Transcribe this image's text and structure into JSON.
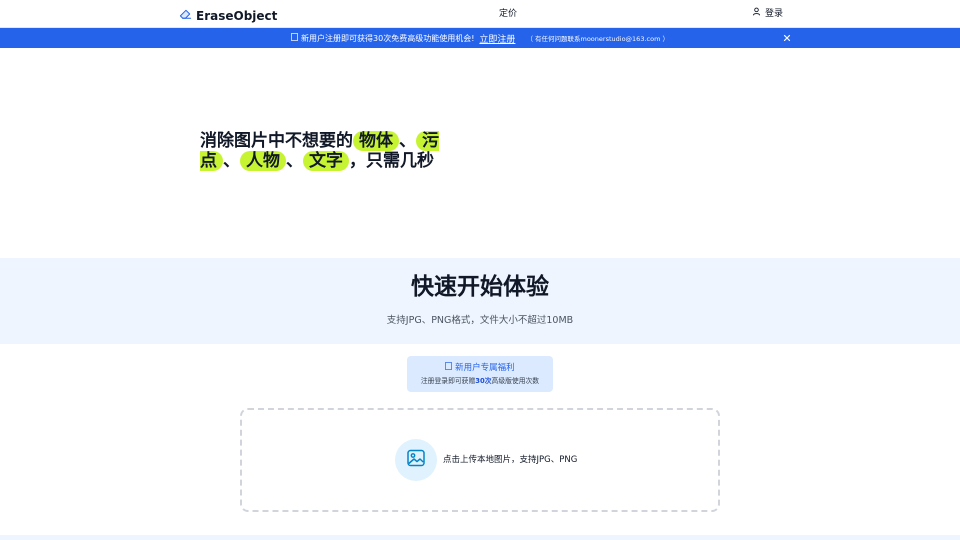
{
  "header": {
    "logo_text": "EraseObject",
    "nav_pricing": "定价",
    "login_label": "登录"
  },
  "banner": {
    "message": "新用户注册即可获得30次免费高级功能使用机会!",
    "register_link": "立即注册",
    "contact": "（ 有任何问题联系moonerstudio@163.com ）"
  },
  "hero": {
    "title_part1": "消除图片中不想要的",
    "hl1": "物体",
    "sep1": "、",
    "hl2": "污点",
    "sep2": "、",
    "hl3": "人物",
    "sep3": "、",
    "hl4": "文字",
    "title_part2": "，只需几秒"
  },
  "quick_start": {
    "title": "快速开始体验",
    "subtitle": "支持JPG、PNG格式，文件大小不超过10MB"
  },
  "benefit": {
    "title": "新用户专属福利",
    "desc_prefix": "注册登录即可获赠",
    "desc_count": "30次",
    "desc_suffix": "高级版使用次数"
  },
  "upload": {
    "text": "点击上传本地图片，支持JPG、PNG"
  },
  "colors": {
    "brand_blue": "#2563eb",
    "highlight_lime": "#c6f432",
    "section_bg": "#eef5fe"
  }
}
